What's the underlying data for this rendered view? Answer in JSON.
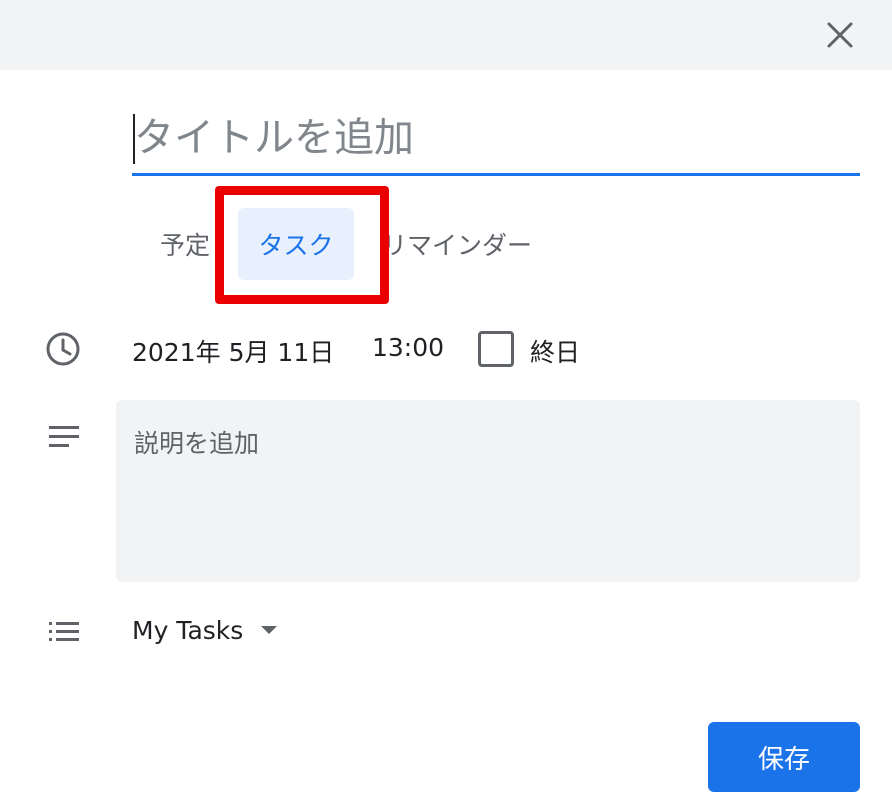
{
  "dialog": {
    "title_placeholder": "タイトルを追加",
    "close_icon": "close-icon"
  },
  "tabs": [
    {
      "label": "予定",
      "selected": false
    },
    {
      "label": "タスク",
      "selected": true
    },
    {
      "label": "リマインダー",
      "selected": false
    }
  ],
  "datetime": {
    "date": "2021年 5月 11日",
    "time": "13:00",
    "all_day_label": "終日",
    "all_day_checked": false
  },
  "description": {
    "placeholder": "説明を追加"
  },
  "task_list": {
    "selected": "My Tasks"
  },
  "actions": {
    "save_label": "保存"
  },
  "colors": {
    "accent": "#1a73e8",
    "highlight": "#ea0000",
    "topbar": "#f1f3f4"
  }
}
